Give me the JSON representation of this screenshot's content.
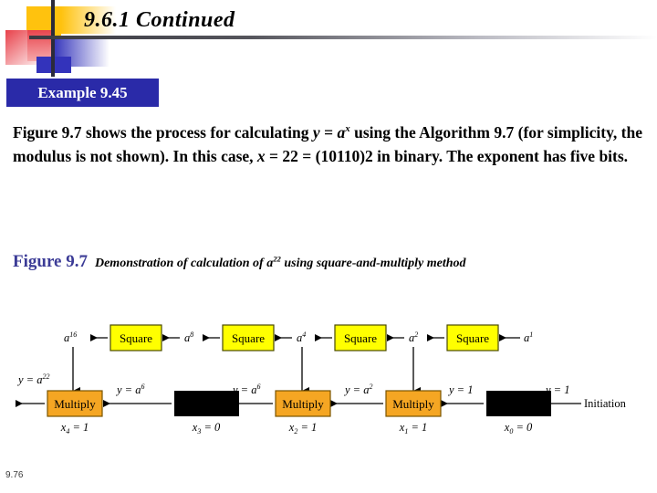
{
  "slide": {
    "title": "9.6.1  Continued",
    "page_number": "9.76",
    "accent_blue": "#2A2AA8",
    "caption_blue": "#3B3B96"
  },
  "example": {
    "banner_label": "Example 9.45"
  },
  "body": {
    "line1_a": "Figure 9.7 shows the process for calculating ",
    "line1_y": "y",
    "line1_eq": " = ",
    "line1_a_base": "a",
    "line1_a_exp": "x",
    "line1_b": " using the Algorithm 9.7 (for simplicity, the modulus is not shown). In this case, ",
    "line3_x": "x",
    "line3_rest": " = 22 = (10110)2 in binary. The exponent has five bits."
  },
  "figure": {
    "caption_number": "Figure 9.7",
    "caption_text_a": "Demonstration of calculation of ",
    "caption_a": "a",
    "caption_exp": "22",
    "caption_text_b": " using square-and-multiply method"
  },
  "diagram": {
    "square_box_color": "#FFFF00",
    "multiply_box_color": "#F5A623",
    "black_box_color": "#000000",
    "square_label": "Square",
    "multiply_label": "Multiply",
    "initiation_label": "Initiation",
    "top_row": [
      {
        "name": "a16",
        "base": "a",
        "exp": "16"
      },
      {
        "name": "square-4",
        "label": "Square"
      },
      {
        "name": "a8",
        "base": "a",
        "exp": "8"
      },
      {
        "name": "square-3",
        "label": "Square"
      },
      {
        "name": "a4",
        "base": "a",
        "exp": "4"
      },
      {
        "name": "square-2",
        "label": "Square"
      },
      {
        "name": "a2",
        "base": "a",
        "exp": "2"
      },
      {
        "name": "square-1",
        "label": "Square"
      },
      {
        "name": "a1",
        "base": "a",
        "exp": "1"
      }
    ],
    "bottom_row": [
      {
        "name": "multiply-x4",
        "type": "multiply",
        "label": "Multiply",
        "bit": "x",
        "bit_sub": "4",
        "bit_val": " = 1",
        "in_label": "y = a",
        "in_exp": "6",
        "out_label": "y = a",
        "out_exp": "22"
      },
      {
        "name": "skip-x3",
        "type": "black",
        "label": "",
        "bit": "x",
        "bit_sub": "3",
        "bit_val": " = 0",
        "in_label": "y = a",
        "in_exp": "6"
      },
      {
        "name": "multiply-x2",
        "type": "multiply",
        "label": "Multiply",
        "bit": "x",
        "bit_sub": "2",
        "bit_val": " = 1",
        "in_label": "y = a",
        "in_exp": "2"
      },
      {
        "name": "multiply-x1",
        "type": "multiply",
        "label": "Multiply",
        "bit": "x",
        "bit_sub": "1",
        "bit_val": " = 1",
        "in_label": "y = 1",
        "in_exp": ""
      },
      {
        "name": "skip-x0",
        "type": "black",
        "label": "",
        "bit": "x",
        "bit_sub": "0",
        "bit_val": " = 0",
        "in_label": "y = 1",
        "in_exp": ""
      }
    ]
  }
}
